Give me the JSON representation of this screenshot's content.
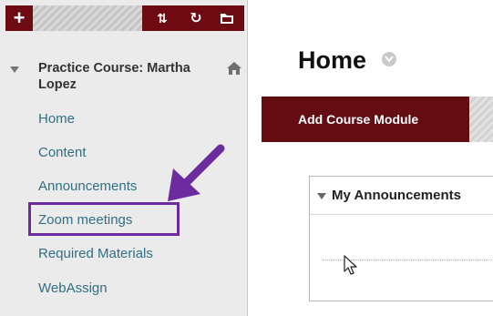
{
  "toolbar": {
    "add_glyph": "+",
    "sort_glyph": "⇅",
    "refresh_glyph": "↻",
    "icons": [
      "add-icon",
      "sort-icon",
      "refresh-icon",
      "folder-icon"
    ]
  },
  "course": {
    "title": "Practice Course: Martha Lopez",
    "home_icon": "home-icon"
  },
  "menu": {
    "items": [
      {
        "label": "Home"
      },
      {
        "label": "Content"
      },
      {
        "label": "Announcements"
      },
      {
        "label": "Zoom meetings"
      },
      {
        "label": "Required Materials"
      },
      {
        "label": "WebAssign"
      }
    ],
    "highlighted_item": "Zoom meetings"
  },
  "page": {
    "title": "Home",
    "add_module_label": "Add Course Module"
  },
  "module": {
    "title": "My Announcements"
  },
  "colors": {
    "brand_maroon": "#630c12",
    "link_teal": "#2f6f86",
    "annotation_purple": "#6c2ca0",
    "sidebar_bg": "#ebebeb"
  }
}
